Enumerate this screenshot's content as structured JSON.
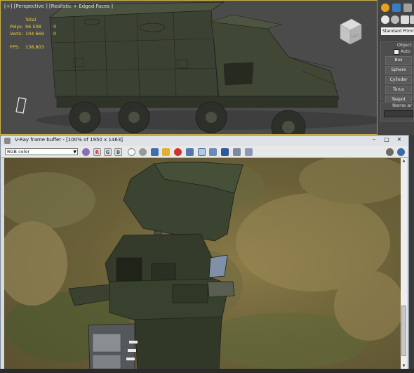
{
  "viewport": {
    "label": "[+] [Perspective ] [Realistic + Edged Faces ]",
    "stats": {
      "header": "Total",
      "rows": [
        {
          "key": "Polys:",
          "value": "96 508",
          "extra": "0"
        },
        {
          "key": "Verts:",
          "value": "104 669",
          "extra": "0"
        }
      ],
      "fps_key": "FPS:",
      "fps_value": "138,803"
    },
    "viewcube_label": "LEFT"
  },
  "command_panel": {
    "dropdown": "Standard Primitiv",
    "object_type": {
      "title": "Object",
      "autogrid": "Auto",
      "buttons": [
        "Box",
        "Sphere",
        "Cylinder",
        "Torus",
        "Teapot"
      ]
    },
    "name_rollout": "Name ar"
  },
  "vfb": {
    "title": "V-Ray frame buffer - [100% of 1950 x 1463]",
    "channel": "RGB color",
    "letters": {
      "r": "R",
      "g": "G",
      "b": "B"
    }
  },
  "colors": {
    "accent": "#c8b04a",
    "stats_text": "#f2d23a",
    "red_channel": "#d02020"
  }
}
